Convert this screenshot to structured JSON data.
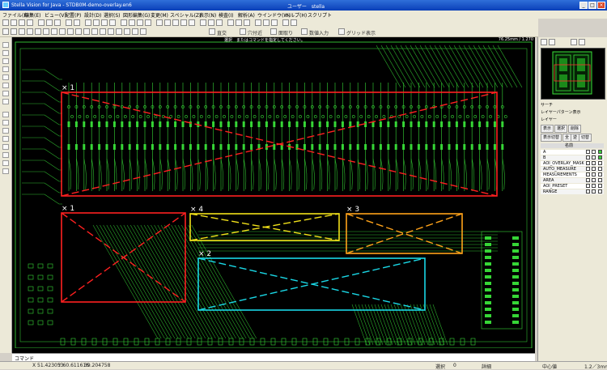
{
  "window": {
    "title": "Stella Vision for Java - STDB0M-demo-overlay.en6",
    "user": "ユーザー　stella",
    "min": "_",
    "max": "□",
    "close": "×"
  },
  "menu": [
    "ファイル(F)",
    "編集(E)",
    "ビュー(V)",
    "配置(P)",
    "設計(D)",
    "選択(S)",
    "図形編集(G)",
    "変更(M)",
    "スペシャル(Z)",
    "表示(N)",
    "検査(I)",
    "解析(A)",
    "ウインドウ(W)",
    "ヘルプ(H)",
    "スクリプト"
  ],
  "toolbar2": {
    "snap_label": "直交",
    "grid_label": "穴付近",
    "mode_label": "面取り",
    "input_label": "数値入力",
    "grid_view_label": "グリッド表示"
  },
  "canvas": {
    "message": "選択　またはコマンドを指定してください。",
    "coords": "76.25mm / 1.270"
  },
  "overlays": [
    {
      "label": "× 1",
      "color": "#ff2020"
    },
    {
      "label": "× 1",
      "color": "#ff2020"
    },
    {
      "label": "× 4",
      "color": "#f2e21a"
    },
    {
      "label": "× 3",
      "color": "#ffa31a"
    },
    {
      "label": "× 2",
      "color": "#1ad8e6"
    }
  ],
  "command": {
    "label": "コマンド"
  },
  "status": {
    "x": "X  51.423053",
    "y": "Y  60.611616",
    "z": "39.204758",
    "select": "選択",
    "count": "0",
    "mode": "詳細",
    "center": "中心値",
    "scale": "1.2／3mm"
  },
  "panel": {
    "search": "サーチ",
    "measure": "レイヤーパターン表示",
    "layer": "レイヤー",
    "tabs": [
      "表示",
      "選択",
      "削除"
    ],
    "layer_buttons": [
      "表示切替",
      "全",
      "逆",
      "切替"
    ],
    "col_name": "名前",
    "layers": [
      {
        "name": "A",
        "color": "#3bd13b"
      },
      {
        "name": "B",
        "color": "#3bd13b"
      },
      {
        "name": "AOI_OVERLAY_MASK",
        "color": "#ffffff"
      },
      {
        "name": "AUTO_MEASURE",
        "color": "#ffffff"
      },
      {
        "name": "MEASUREMENTS",
        "color": "#ffffff"
      },
      {
        "name": "AREA",
        "color": "#ffffff"
      },
      {
        "name": "AOI_PRESET",
        "color": "#ffffff"
      },
      {
        "name": "RANGE",
        "color": "#ffffff"
      }
    ]
  },
  "colors": {
    "trace": "#2fb82f",
    "canvas_bg": "#000000",
    "pad": "#36d636"
  }
}
